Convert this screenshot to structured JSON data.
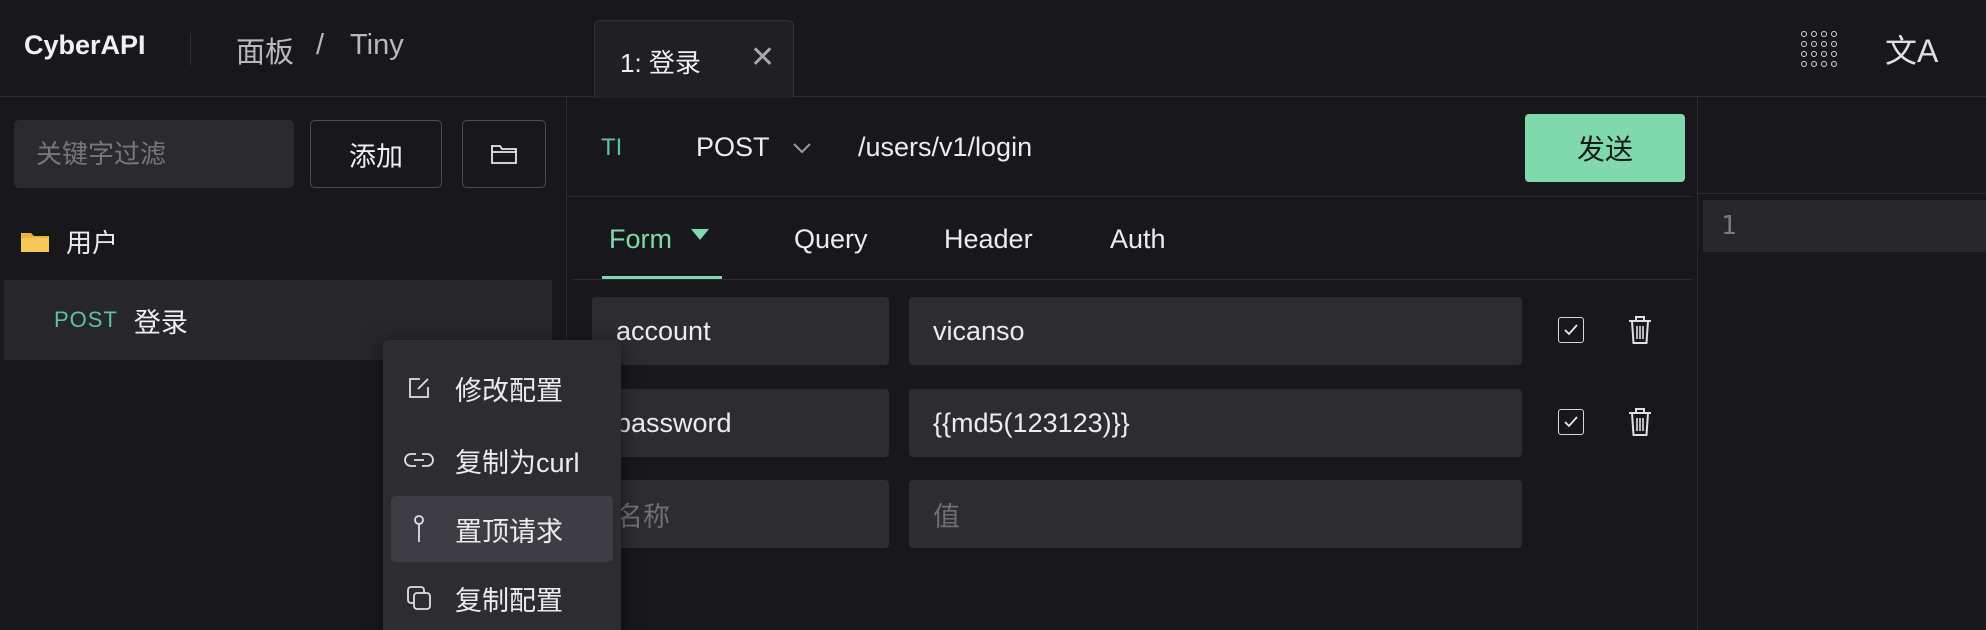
{
  "app": {
    "logo": "CyberAPI",
    "breadcrumb": {
      "first": "面板",
      "separator": "/",
      "second": "Tiny"
    }
  },
  "tabs": [
    {
      "label": "1: 登录",
      "close": "✕"
    }
  ],
  "header_icons": {
    "apps": "apps-grid-icon",
    "translate": "translate-icon",
    "translate_glyph": "文A"
  },
  "sidebar": {
    "search_placeholder": "关键字过滤",
    "add_label": "添加",
    "folder_button_icon": "folder-outline-icon",
    "folder": {
      "icon": "folder-icon",
      "label": "用户"
    },
    "requests": [
      {
        "method": "POST",
        "name": "登录"
      }
    ]
  },
  "context_menu": {
    "items": [
      {
        "icon": "edit-icon",
        "label": "修改配置"
      },
      {
        "icon": "link-icon",
        "label": "复制为curl"
      },
      {
        "icon": "pin-icon",
        "label": "置顶请求",
        "active": true
      },
      {
        "icon": "copy-icon",
        "label": "复制配置"
      }
    ]
  },
  "request": {
    "tag": "TI",
    "method": "POST",
    "url": "/users/v1/login",
    "send_label": "发送"
  },
  "param_tabs": [
    {
      "label": "Form",
      "active": true
    },
    {
      "label": "Query"
    },
    {
      "label": "Header"
    },
    {
      "label": "Auth"
    }
  ],
  "form_rows": [
    {
      "name": "account",
      "value": "vicanso",
      "enabled": true
    },
    {
      "name": "password",
      "value": "{{md5(123123)}}",
      "enabled": true
    }
  ],
  "new_row": {
    "name_placeholder": "名称",
    "value_placeholder": "值"
  },
  "response": {
    "line_numbers": [
      "1"
    ]
  },
  "colors": {
    "accent": "#7fd9ac",
    "method": "#5fc29a",
    "background": "#18181c",
    "field": "#2c2c31"
  }
}
